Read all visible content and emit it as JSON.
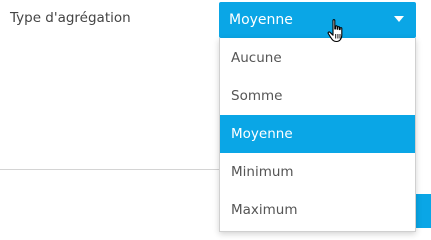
{
  "field": {
    "label": "Type d'agrégation"
  },
  "select": {
    "value": "Moyenne",
    "options": [
      {
        "label": "Aucune",
        "selected": false
      },
      {
        "label": "Somme",
        "selected": false
      },
      {
        "label": "Moyenne",
        "selected": true
      },
      {
        "label": "Minimum",
        "selected": false
      },
      {
        "label": "Maximum",
        "selected": false
      }
    ]
  },
  "icons": {
    "dropdown": "chevron-down-icon",
    "cursor": "hand-pointer-icon"
  },
  "colors": {
    "accent": "#0aa6e6",
    "selected_text": "#ffffff"
  }
}
